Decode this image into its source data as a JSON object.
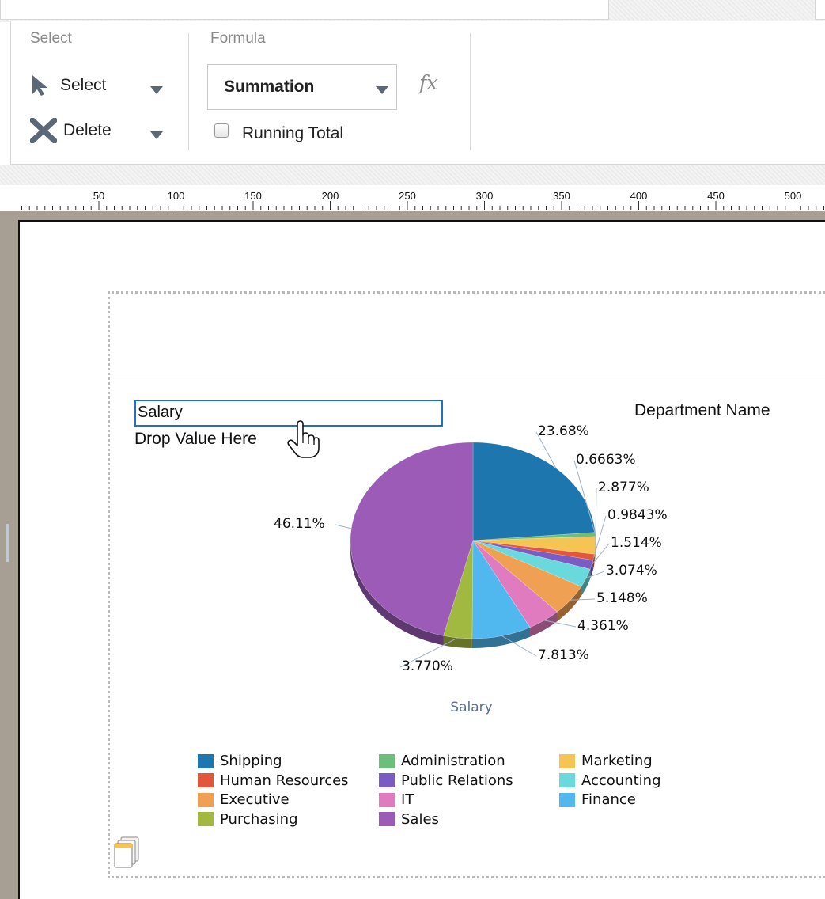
{
  "ribbon": {
    "select_group": {
      "title": "Select",
      "select_label": "Select",
      "delete_label": "Delete"
    },
    "formula_group": {
      "title": "Formula",
      "combo_value": "Summation",
      "fx_label": "fx",
      "running_total_label": "Running Total",
      "running_total_checked": false
    }
  },
  "ruler": {
    "labels": [
      "50",
      "100",
      "150",
      "200",
      "250",
      "300",
      "350",
      "400",
      "450",
      "500"
    ]
  },
  "chart_widget": {
    "value_field": "Salary",
    "drop_hint": "Drop Value Here",
    "series_field": "Department Name"
  },
  "icons": [
    "select-arrow-icon",
    "delete-x-icon",
    "dropdown-arrow-icon",
    "fx-icon",
    "hand-cursor-icon",
    "pages-icon"
  ],
  "chart_data": {
    "type": "pie",
    "title": "Salary",
    "slices": [
      {
        "label": "Shipping",
        "value": 23.68,
        "value_label": "23.68%",
        "color": "#1d76ae"
      },
      {
        "label": "Administration",
        "value": 0.6663,
        "value_label": "0.6663%",
        "color": "#6cbf7a"
      },
      {
        "label": "Marketing",
        "value": 2.877,
        "value_label": "2.877%",
        "color": "#f6c453"
      },
      {
        "label": "Human Resources",
        "value": 0.9843,
        "value_label": "0.9843%",
        "color": "#e0573b"
      },
      {
        "label": "Public Relations",
        "value": 1.514,
        "value_label": "1.514%",
        "color": "#7b5cc2"
      },
      {
        "label": "Accounting",
        "value": 3.074,
        "value_label": "3.074%",
        "color": "#6ad9dc"
      },
      {
        "label": "Executive",
        "value": 5.148,
        "value_label": "5.148%",
        "color": "#f0a052"
      },
      {
        "label": "IT",
        "value": 4.361,
        "value_label": "4.361%",
        "color": "#e07bbf"
      },
      {
        "label": "Finance",
        "value": 7.813,
        "value_label": "7.813%",
        "color": "#51b7ef"
      },
      {
        "label": "Purchasing",
        "value": 3.77,
        "value_label": "3.770%",
        "color": "#a2b941"
      },
      {
        "label": "Sales",
        "value": 46.11,
        "value_label": "46.11%",
        "color": "#9b5bb6"
      }
    ],
    "legend": {
      "columns": [
        [
          "Shipping",
          "Human Resources",
          "Executive",
          "Purchasing"
        ],
        [
          "Administration",
          "Public Relations",
          "IT",
          "Sales"
        ],
        [
          "Marketing",
          "Accounting",
          "Finance"
        ]
      ]
    }
  }
}
